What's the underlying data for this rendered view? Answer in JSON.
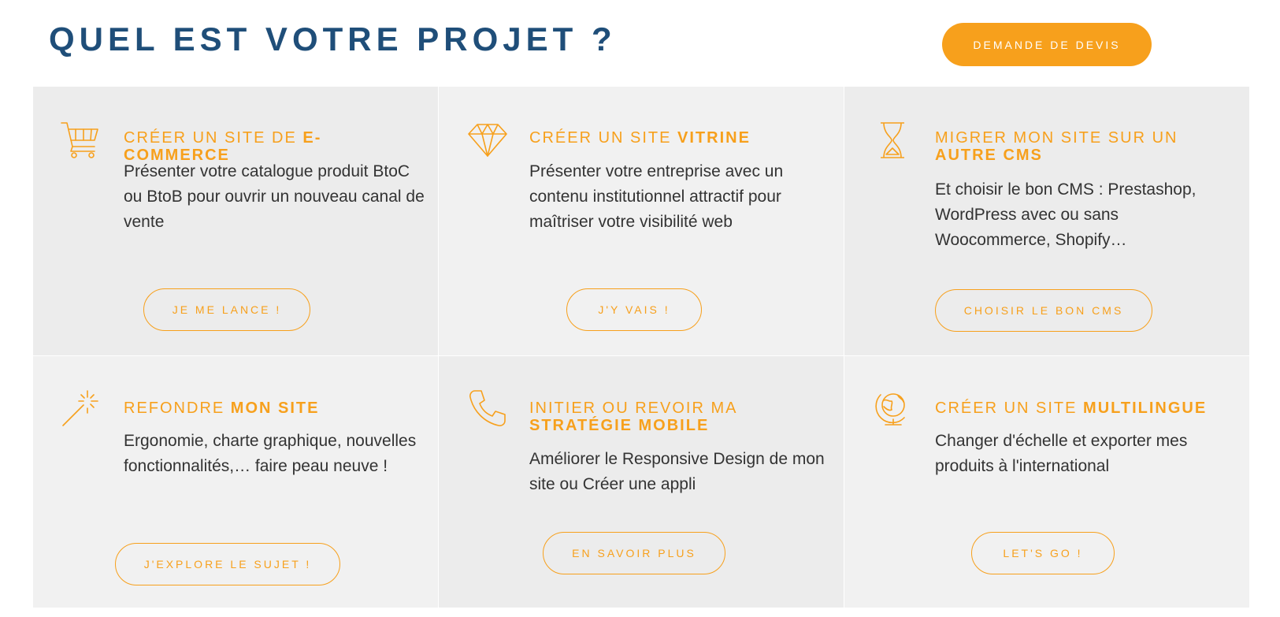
{
  "header": {
    "title": "QUEL EST VOTRE PROJET ?",
    "cta_label": "DEMANDE DE DEVIS"
  },
  "colors": {
    "accent": "#f7a01c",
    "title": "#1f4e79",
    "text": "#333333",
    "card_a": "#ececec",
    "card_b": "#f1f1f1"
  },
  "cards": [
    {
      "icon": "shopping-cart-icon",
      "title_plain": "CRÉER UN SITE DE ",
      "title_bold": "E-COMMERCE",
      "text": "Présenter votre catalogue produit BtoC ou BtoB pour ouvrir un nouveau canal de vente",
      "button": "JE ME LANCE !"
    },
    {
      "icon": "diamond-icon",
      "title_plain": "CRÉER UN SITE ",
      "title_bold": "VITRINE",
      "text": "Présenter votre entreprise avec un contenu institutionnel attractif pour maîtriser votre visibilité web",
      "button": "J'Y VAIS !"
    },
    {
      "icon": "hourglass-icon",
      "title_plain": "MIGRER MON SITE SUR UN ",
      "title_bold": "AUTRE CMS",
      "text": "Et choisir le bon CMS : Prestashop, WordPress avec ou sans Woocommerce, Shopify…",
      "button": "CHOISIR LE BON CMS"
    },
    {
      "icon": "magic-wand-icon",
      "title_plain": "REFONDRE ",
      "title_bold": "MON SITE",
      "text": "Ergonomie, charte graphique, nouvelles fonctionnalités,… faire peau neuve !",
      "button": "J'EXPLORE LE SUJET !"
    },
    {
      "icon": "phone-icon",
      "title_plain": "INITIER OU REVOIR MA ",
      "title_bold": "STRATÉGIE MOBILE",
      "text": "Améliorer le Responsive Design de mon site ou Créer une appli",
      "button": "EN SAVOIR PLUS"
    },
    {
      "icon": "globe-icon",
      "title_plain": "CRÉER UN SITE ",
      "title_bold": "MULTILINGUE",
      "text": "Changer d'échelle et exporter mes produits à l'international",
      "button": "LET'S GO !"
    }
  ]
}
